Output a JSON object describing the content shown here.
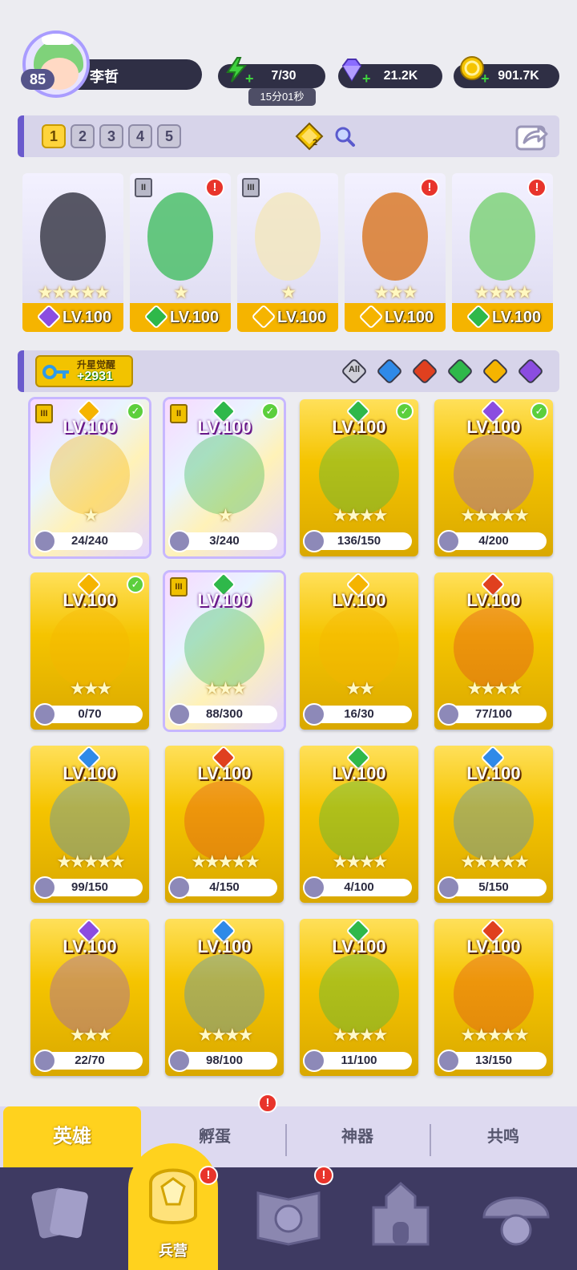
{
  "player": {
    "level": "85",
    "name": "李哲"
  },
  "resources": {
    "energy": {
      "value": "7/30",
      "timer": "15分01秒",
      "icon": "lightning-icon",
      "color": "#3fd13f"
    },
    "gems": {
      "value": "21.2K",
      "icon": "diamond-icon",
      "color": "#8a6cff"
    },
    "gold": {
      "value": "901.7K",
      "icon": "coin-icon",
      "color": "#f5c400"
    }
  },
  "team_slots": [
    "1",
    "2",
    "3",
    "4",
    "5"
  ],
  "team_slot_active": "1",
  "team_bonus_badge": "2",
  "team_cards": [
    {
      "level": "LV.100",
      "stars": "★★★★★",
      "element": "shadow",
      "alert": false,
      "rank": ""
    },
    {
      "level": "LV.100",
      "stars": "★",
      "element": "nature",
      "alert": true,
      "rank": "II"
    },
    {
      "level": "LV.100",
      "stars": "★",
      "element": "light",
      "alert": false,
      "rank": "III"
    },
    {
      "level": "LV.100",
      "stars": "★★★",
      "element": "light",
      "alert": true,
      "rank": ""
    },
    {
      "level": "LV.100",
      "stars": "★★★★",
      "element": "nature",
      "alert": true,
      "rank": ""
    }
  ],
  "awaken": {
    "title": "升星觉醒",
    "value": "+2931"
  },
  "filters": [
    {
      "label": "All",
      "icon": "all-filter-icon"
    },
    {
      "label": "",
      "icon": "water-element-icon"
    },
    {
      "label": "",
      "icon": "fire-element-icon"
    },
    {
      "label": "",
      "icon": "nature-element-icon"
    },
    {
      "label": "",
      "icon": "light-element-icon"
    },
    {
      "label": "",
      "icon": "shadow-element-icon"
    }
  ],
  "heroes": [
    {
      "level": "LV.100",
      "stars": "★",
      "shards": "24/240",
      "element": "light",
      "holo": true,
      "check": true,
      "rank": "III"
    },
    {
      "level": "LV.100",
      "stars": "★",
      "shards": "3/240",
      "element": "nature",
      "holo": true,
      "check": true,
      "rank": "II"
    },
    {
      "level": "LV.100",
      "stars": "★★★★",
      "shards": "136/150",
      "element": "nature",
      "holo": false,
      "check": true,
      "rank": ""
    },
    {
      "level": "LV.100",
      "stars": "★★★★★",
      "shards": "4/200",
      "element": "shadow",
      "holo": false,
      "check": true,
      "rank": ""
    },
    {
      "level": "LV.100",
      "stars": "★★★",
      "shards": "0/70",
      "element": "light",
      "holo": false,
      "check": true,
      "rank": ""
    },
    {
      "level": "LV.100",
      "stars": "★★★",
      "shards": "88/300",
      "element": "nature",
      "holo": true,
      "check": false,
      "rank": "III"
    },
    {
      "level": "LV.100",
      "stars": "★★",
      "shards": "16/30",
      "element": "light",
      "holo": false,
      "check": false,
      "rank": ""
    },
    {
      "level": "LV.100",
      "stars": "★★★★",
      "shards": "77/100",
      "element": "fire",
      "holo": false,
      "check": false,
      "rank": ""
    },
    {
      "level": "LV.100",
      "stars": "★★★★★",
      "shards": "99/150",
      "element": "water",
      "holo": false,
      "check": false,
      "rank": ""
    },
    {
      "level": "LV.100",
      "stars": "★★★★★",
      "shards": "4/150",
      "element": "fire",
      "holo": false,
      "check": false,
      "rank": ""
    },
    {
      "level": "LV.100",
      "stars": "★★★★",
      "shards": "4/100",
      "element": "nature",
      "holo": false,
      "check": false,
      "rank": ""
    },
    {
      "level": "LV.100",
      "stars": "★★★★★",
      "shards": "5/150",
      "element": "water",
      "holo": false,
      "check": false,
      "rank": ""
    },
    {
      "level": "LV.100",
      "stars": "★★★",
      "shards": "22/70",
      "element": "shadow",
      "holo": false,
      "check": false,
      "rank": ""
    },
    {
      "level": "LV.100",
      "stars": "★★★★",
      "shards": "98/100",
      "element": "water",
      "holo": false,
      "check": false,
      "rank": ""
    },
    {
      "level": "LV.100",
      "stars": "★★★★",
      "shards": "11/100",
      "element": "nature",
      "holo": false,
      "check": false,
      "rank": ""
    },
    {
      "level": "LV.100",
      "stars": "★★★★★",
      "shards": "13/150",
      "element": "fire",
      "holo": false,
      "check": false,
      "rank": ""
    }
  ],
  "element_colors": {
    "light": "#f5b400",
    "nature": "#2fb84a",
    "shadow": "#8b4de0",
    "fire": "#e0401f",
    "water": "#2f8ae8"
  },
  "subtabs": [
    {
      "label": "英雄",
      "active": true,
      "alert": false
    },
    {
      "label": "孵蛋",
      "active": false,
      "alert": true
    },
    {
      "label": "神器",
      "active": false,
      "alert": false
    },
    {
      "label": "共鸣",
      "active": false,
      "alert": false
    }
  ],
  "bottom_nav": [
    {
      "label": "",
      "icon": "cards-icon"
    },
    {
      "label": "兵营",
      "icon": "barracks-icon",
      "active": true,
      "alert": true
    },
    {
      "label": "",
      "icon": "book-icon",
      "alert": true
    },
    {
      "label": "",
      "icon": "castle-icon"
    },
    {
      "label": "",
      "icon": "guild-icon"
    }
  ],
  "alert_mark": "!"
}
